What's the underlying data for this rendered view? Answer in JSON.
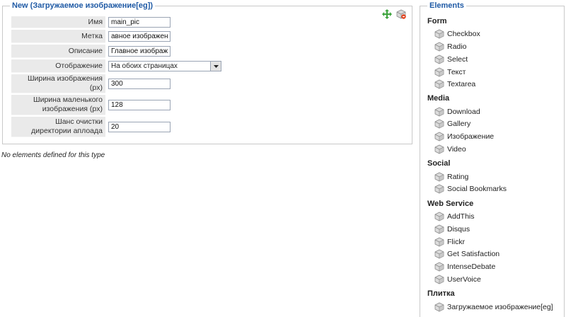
{
  "left_panel": {
    "legend": "New (Загружаемое изображение[eg])",
    "fields": {
      "name": {
        "label": "Имя",
        "value": "main_pic"
      },
      "tag": {
        "label": "Метка",
        "value": "авное изображение"
      },
      "description": {
        "label": "Описание",
        "value": "Главное изображен"
      },
      "display": {
        "label": "Отображение",
        "value": "На обоих страницах"
      },
      "image_width": {
        "label": "Ширина изображения (px)",
        "value": "300"
      },
      "thumb_width": {
        "label": "Ширина маленького изображения (px)",
        "value": "128"
      },
      "clean_chance": {
        "label": "Шанс очистки директории аплоада",
        "value": "20"
      }
    },
    "no_elements_text": "No elements defined for this type"
  },
  "right_panel": {
    "legend": "Elements",
    "groups": [
      {
        "title": "Form",
        "items": [
          "Checkbox",
          "Radio",
          "Select",
          "Текст",
          "Textarea"
        ]
      },
      {
        "title": "Media",
        "items": [
          "Download",
          "Gallery",
          "Изображение",
          "Video"
        ]
      },
      {
        "title": "Social",
        "items": [
          "Rating",
          "Social Bookmarks"
        ]
      },
      {
        "title": "Web Service",
        "items": [
          "AddThis",
          "Disqus",
          "Flickr",
          "Get Satisfaction",
          "IntenseDebate",
          "UserVoice"
        ]
      },
      {
        "title": "Плитка",
        "items": [
          "Загружаемое изображение[eg]"
        ]
      }
    ]
  },
  "colors": {
    "legend": "#1f5aa5",
    "label_bg": "#eaeaea",
    "move_icon": "#3ca33c"
  },
  "icons": {
    "move": "move-icon",
    "delete": "delete-icon",
    "element": "element-icon"
  }
}
